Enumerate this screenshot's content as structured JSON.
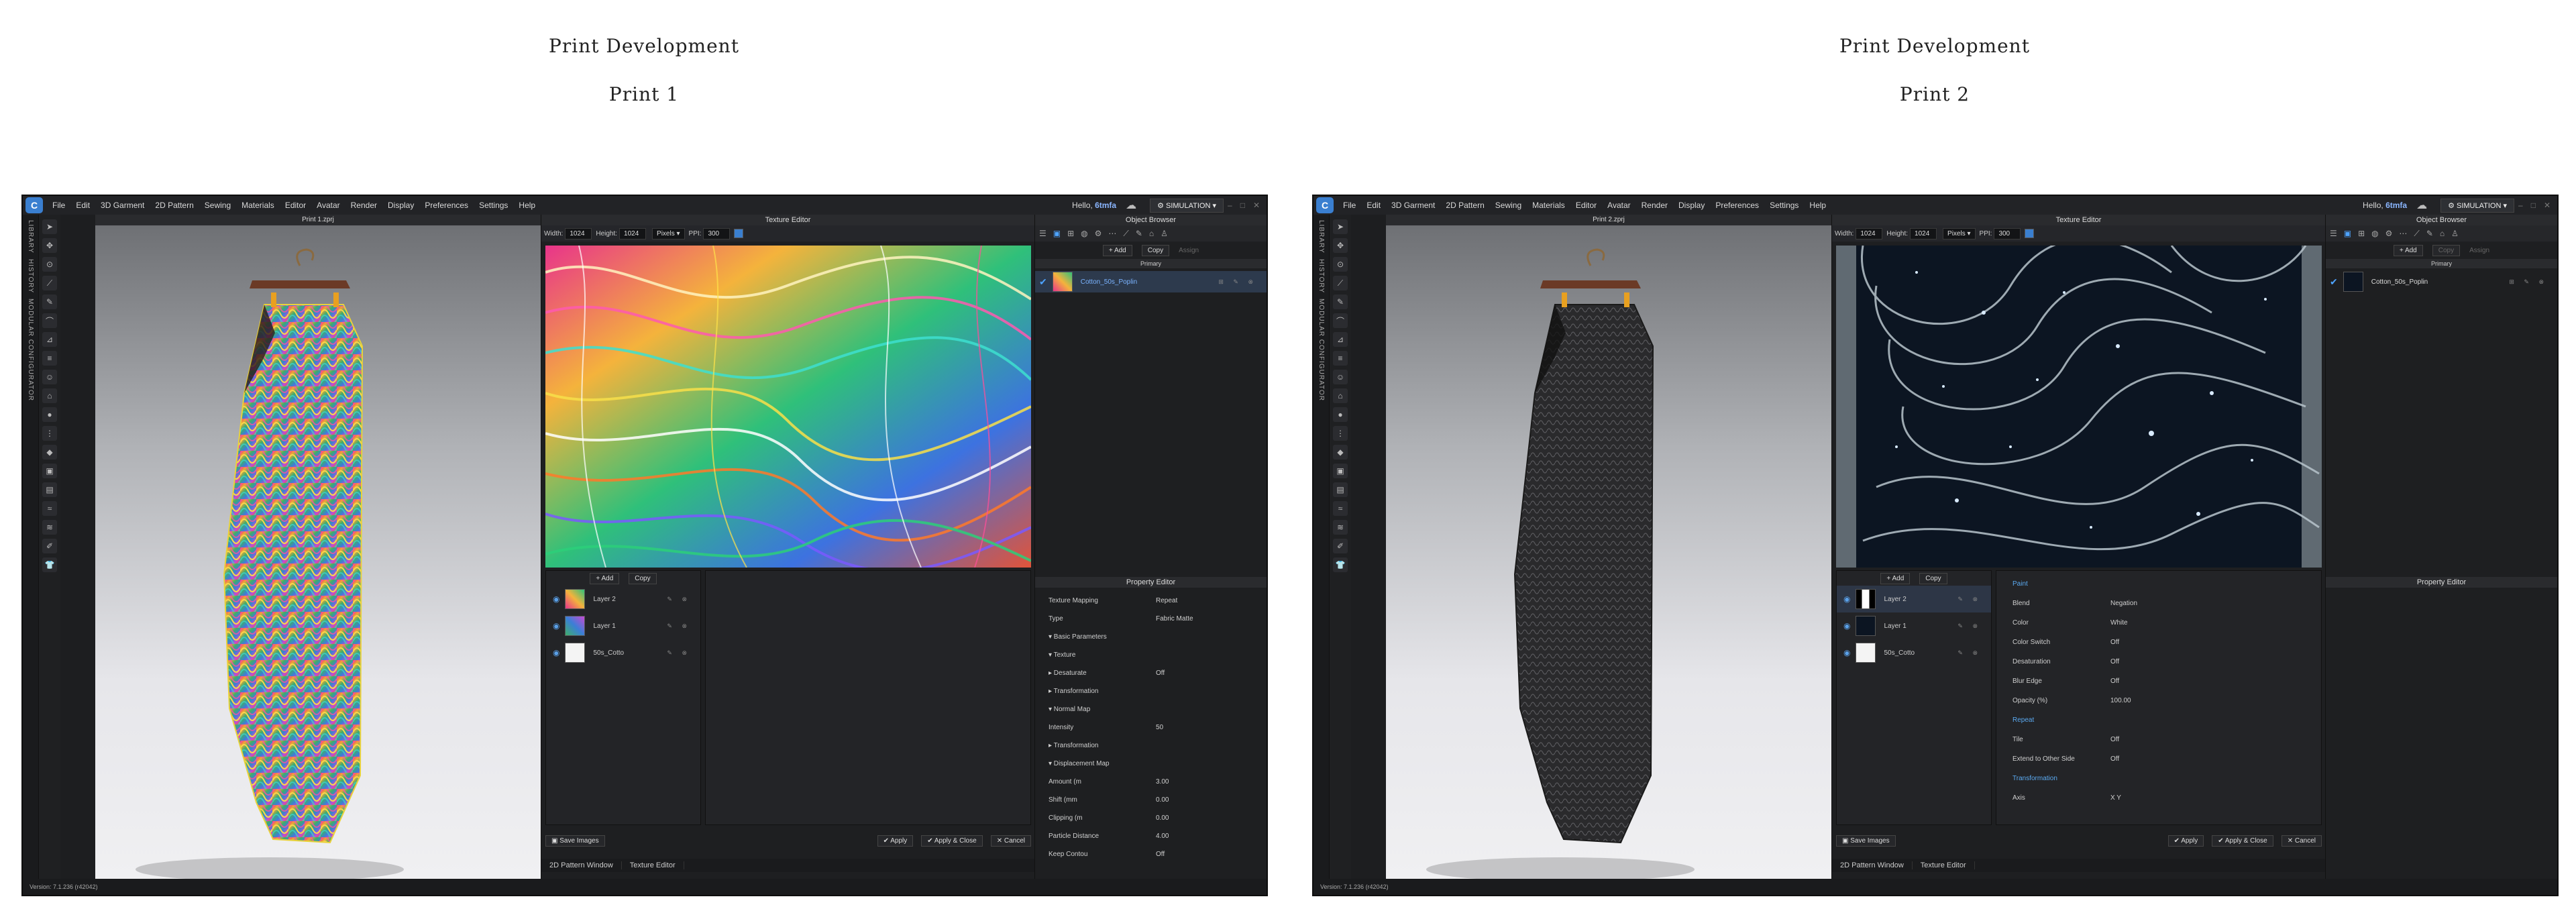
{
  "headings": [
    {
      "title": "Print Development",
      "subtitle": "Print 1"
    },
    {
      "title": "Print Development",
      "subtitle": "Print 2"
    }
  ],
  "menu": [
    "File",
    "Edit",
    "3D Garment",
    "2D Pattern",
    "Sewing",
    "Materials",
    "Editor",
    "Avatar",
    "Render",
    "Display",
    "Preferences",
    "Settings",
    "Help"
  ],
  "user": {
    "hello": "Hello,",
    "name": "6tmfa"
  },
  "mode": "SIMULATION",
  "sidebar_tabs": [
    "LIBRARY",
    "HISTORY",
    "MODULAR CONFIGURATOR"
  ],
  "version": "Version: 7.1.236 (r42042)",
  "texture_editor": {
    "title": "Texture Editor",
    "width_label": "Width:",
    "width": "1024",
    "height_label": "Height:",
    "height": "1024",
    "unit": "Pixels",
    "ppi_label": "PPI:",
    "ppi": "300"
  },
  "layers": {
    "add": "+ Add",
    "copy": "Copy",
    "items": [
      "Layer 2",
      "Layer 1",
      "50s_Cotto"
    ]
  },
  "buttons": {
    "save_images": "Save Images",
    "apply": "Apply",
    "apply_close": "Apply & Close",
    "cancel": "Cancel"
  },
  "bottom_tabs": [
    "2D Pattern Window",
    "Texture Editor"
  ],
  "object_browser": {
    "title": "Object Browser",
    "add": "+ Add",
    "copy": "Copy",
    "assign": "Assign",
    "primary": "Primary",
    "fabric": "Cotton_50s_Poplin"
  },
  "property_editor_title": "Property Editor",
  "window1": {
    "view_title": "Print 1.zprj",
    "props": [
      {
        "label": "Texture Mapping",
        "value": "Repeat"
      },
      {
        "label": "Type",
        "value": "Fabric Matte"
      },
      {
        "label": "▾ Basic Parameters",
        "value": ""
      },
      {
        "label": "▾ Texture",
        "value": ""
      },
      {
        "label": "▸ Desaturate",
        "value": "Off"
      },
      {
        "label": "▸ Transformation",
        "value": ""
      },
      {
        "label": "▾ Normal Map",
        "value": ""
      },
      {
        "label": "Intensity",
        "value": "50"
      },
      {
        "label": "▸ Transformation",
        "value": ""
      },
      {
        "label": "▾ Displacement Map",
        "value": ""
      },
      {
        "label": "Amount (m",
        "value": "3.00"
      },
      {
        "label": "Shift (mm",
        "value": "0.00"
      },
      {
        "label": "Clipping (m",
        "value": "0.00"
      },
      {
        "label": "Particle Distance",
        "value": "4.00"
      },
      {
        "label": "Keep Contou",
        "value": "Off"
      }
    ]
  },
  "window2": {
    "view_title": "Print 2.zprj",
    "props": [
      {
        "label": "Paint",
        "value": ""
      },
      {
        "label": "Blend",
        "value": "Negation"
      },
      {
        "label": "Color",
        "value": "White"
      },
      {
        "label": "Color Switch",
        "value": "Off"
      },
      {
        "label": "Desaturation",
        "value": "Off"
      },
      {
        "label": "Blur Edge",
        "value": "Off"
      },
      {
        "label": "Opacity (%)",
        "value": "100.00"
      },
      {
        "label": "Repeat",
        "value": ""
      },
      {
        "label": "Tile",
        "value": "Off"
      },
      {
        "label": "Extend to Other Side",
        "value": "Off"
      },
      {
        "label": "Transformation",
        "value": ""
      },
      {
        "label": "Axis",
        "value": "X     Y"
      }
    ]
  },
  "colors": {
    "accent": "#4ea4ff",
    "window_bg": "#1d1e20",
    "selection": "#2d3646"
  }
}
